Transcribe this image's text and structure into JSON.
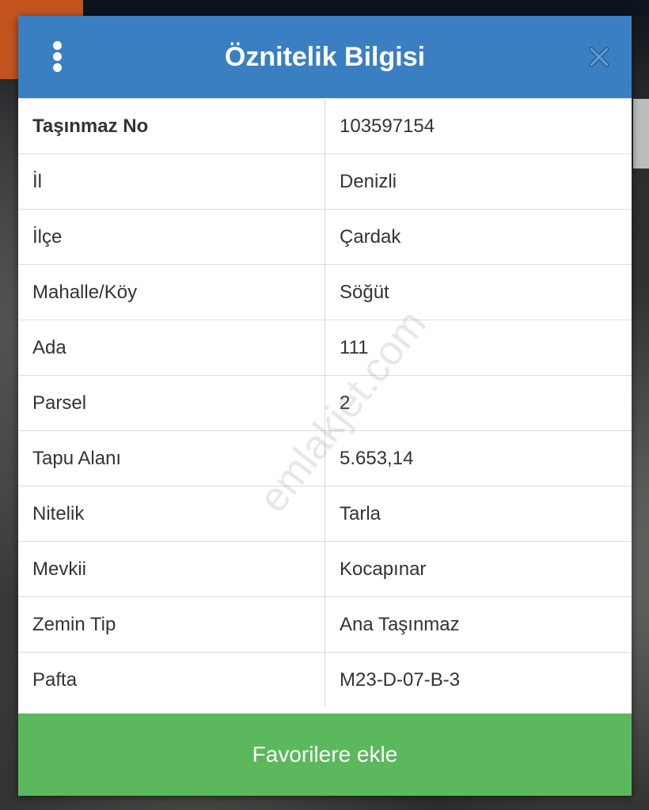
{
  "dialog": {
    "title": "Öznitelik Bilgisi",
    "menu_icon": "kebab-menu-icon",
    "close_icon": "close-icon",
    "header_color": "#3a7fc1"
  },
  "rows": [
    {
      "key": "Taşınmaz No",
      "value": "103597154"
    },
    {
      "key": "İl",
      "value": "Denizli"
    },
    {
      "key": "İlçe",
      "value": "Çardak"
    },
    {
      "key": "Mahalle/Köy",
      "value": "Söğüt"
    },
    {
      "key": "Ada",
      "value": "111"
    },
    {
      "key": "Parsel",
      "value": "2"
    },
    {
      "key": "Tapu Alanı",
      "value": "5.653,14"
    },
    {
      "key": "Nitelik",
      "value": "Tarla"
    },
    {
      "key": "Mevkii",
      "value": "Kocapınar"
    },
    {
      "key": "Zemin Tip",
      "value": "Ana Taşınmaz"
    },
    {
      "key": "Pafta",
      "value": "M23-D-07-B-3"
    }
  ],
  "actions": {
    "favorite_label": "Favorilere ekle",
    "favorite_color": "#5cb85c"
  },
  "watermark": "emlakjet.com"
}
